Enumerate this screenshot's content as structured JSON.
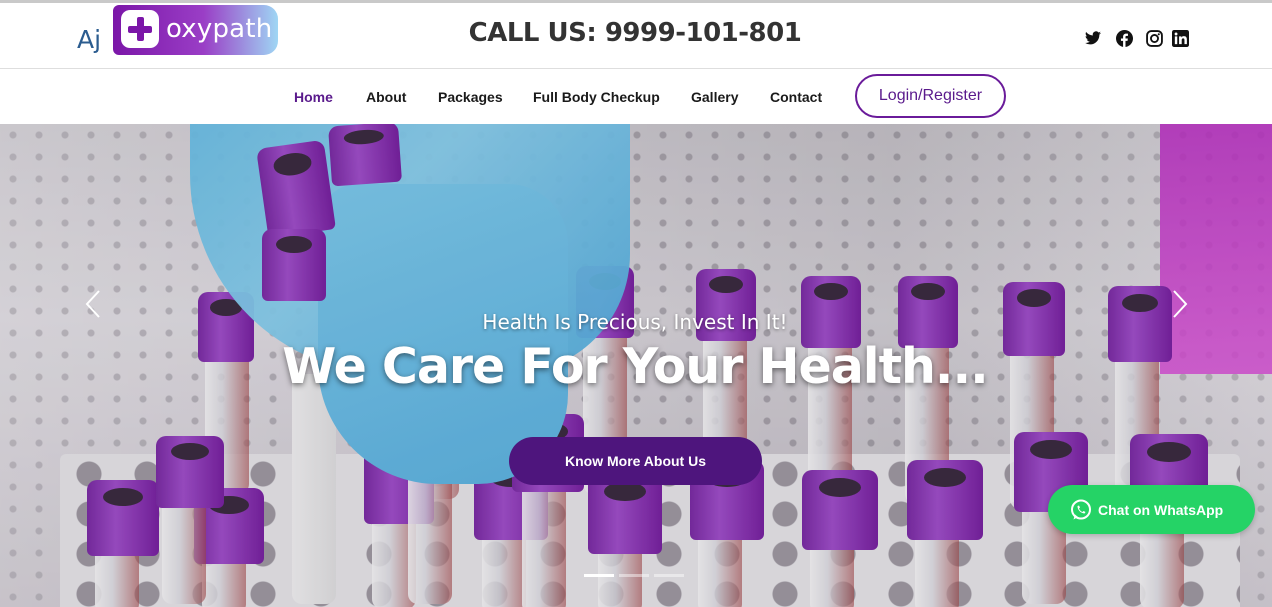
{
  "brand": {
    "prefix": "Aj",
    "name": "oxypath",
    "colors": {
      "primary": "#6a1b9a",
      "accent": "#7b16a8",
      "whatsapp": "#25d366"
    }
  },
  "header": {
    "call_us": "CALL US: 9999-101-801",
    "social_icons": [
      "twitter-icon",
      "facebook-icon",
      "instagram-icon",
      "linkedin-icon"
    ]
  },
  "nav": {
    "items": [
      {
        "label": "Home",
        "active": true
      },
      {
        "label": "About"
      },
      {
        "label": "Packages"
      },
      {
        "label": "Full Body Checkup"
      },
      {
        "label": "Gallery"
      },
      {
        "label": "Contact"
      }
    ],
    "login_label": "Login/Register"
  },
  "hero": {
    "tagline": "Health Is Precious, Invest In It!",
    "headline": "We Care For Your Health...",
    "cta_label": "Know More About Us",
    "slides_count": 3,
    "active_slide": 1
  },
  "whatsapp": {
    "label": "Chat on WhatsApp"
  }
}
